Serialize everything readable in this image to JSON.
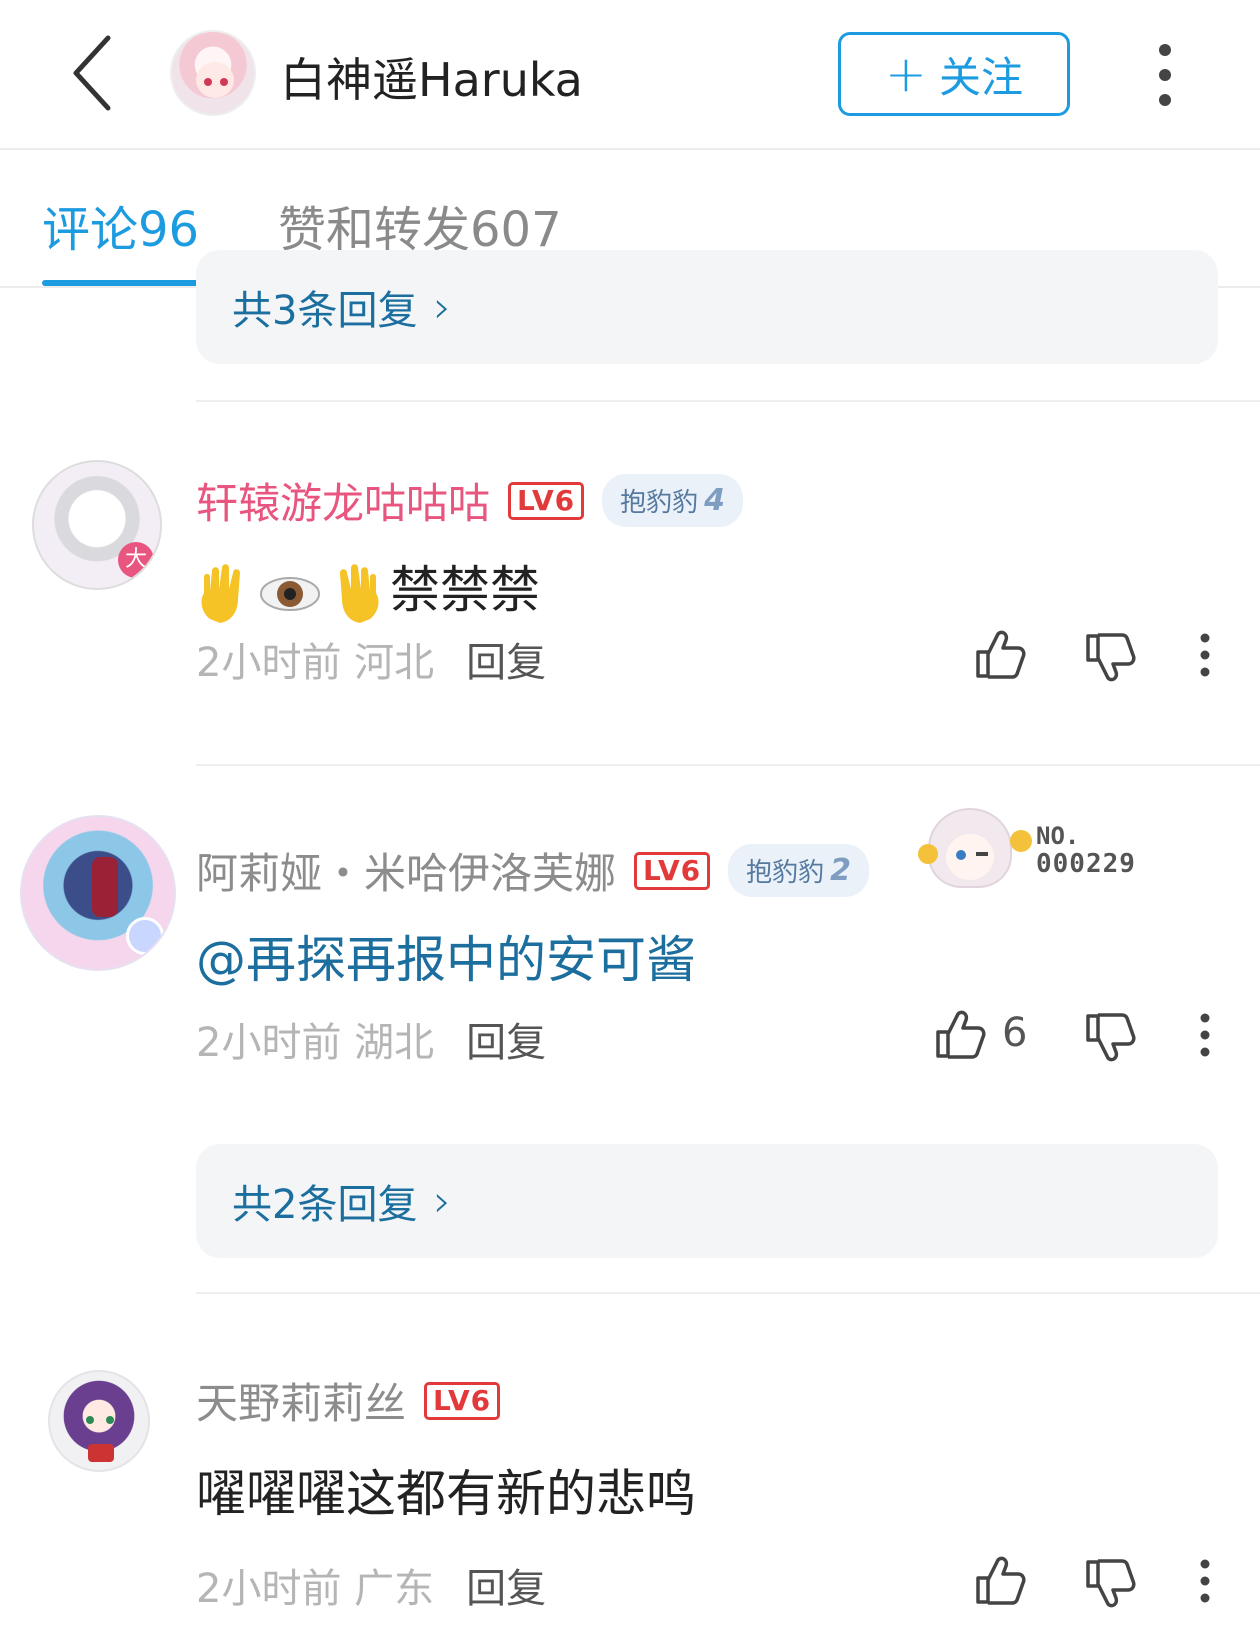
{
  "header": {
    "title": "白神遥Haruka",
    "follow_label": "关注",
    "accent_color": "#1d9be0"
  },
  "tabs": [
    {
      "label": "评论",
      "count": "96",
      "active": true
    },
    {
      "label": "赞和转发",
      "count": "607",
      "active": false
    }
  ],
  "comments": [
    {
      "replies_label_before": "共3条回复",
      "name": "轩辕游龙咕咕咕",
      "name_color": "#e8567f",
      "level": "LV6",
      "fan_badge": {
        "label": "抱豹豹",
        "level": "4"
      },
      "text": "禁禁禁",
      "emoji_prefix": [
        "raised-hand-icon",
        "eye-icon",
        "raised-hand-icon"
      ],
      "time": "2小时前",
      "location": "河北",
      "reply_label": "回复",
      "likes": ""
    },
    {
      "name": "阿莉娅・米哈伊洛芙娜",
      "name_color": "#8c8c8c",
      "level": "LV6",
      "fan_badge": {
        "label": "抱豹豹",
        "level": "2"
      },
      "number_badge": {
        "prefix": "NO.",
        "number": "000229"
      },
      "text": "@再探再报中的安可酱",
      "text_color": "#1b6e9e",
      "time": "2小时前",
      "location": "湖北",
      "reply_label": "回复",
      "likes": "6",
      "replies_label": "共2条回复"
    },
    {
      "name": "天野莉莉丝",
      "name_color": "#8c8c8c",
      "level": "LV6",
      "text": "嚁嚁嚁这都有新的悲鸣",
      "time": "2小时前",
      "location": "广东",
      "reply_label": "回复",
      "likes": ""
    }
  ]
}
